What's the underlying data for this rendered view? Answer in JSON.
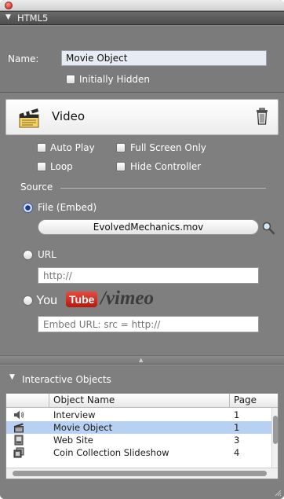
{
  "panel": {
    "section_title": "HTML5",
    "name_label": "Name:",
    "name_value": "Movie Object",
    "initially_hidden_label": "Initially Hidden"
  },
  "video": {
    "title": "Video",
    "options": {
      "auto_play": "Auto Play",
      "full_screen_only": "Full Screen Only",
      "loop": "Loop",
      "hide_controller": "Hide Controller"
    },
    "source_label": "Source",
    "file_option": "File (Embed)",
    "file_name": "EvolvedMechanics.mov",
    "url_option": "URL",
    "url_placeholder": "http://",
    "youtube_you": "You",
    "youtube_tube": "Tube",
    "vimeo_text": "/vimeo",
    "embed_placeholder": "Embed URL: src = http://",
    "selected_source": "File (Embed)"
  },
  "interactive_objects": {
    "title": "Interactive Objects",
    "columns": [
      "Object Name",
      "Page"
    ],
    "rows": [
      {
        "name": "Interview",
        "page": "1",
        "icon": "speaker-icon"
      },
      {
        "name": "Movie Object",
        "page": "1",
        "icon": "clapperboard-icon"
      },
      {
        "name": "Web Site",
        "page": "3",
        "icon": "web-widget-icon"
      },
      {
        "name": "Coin Collection Slideshow",
        "page": "4",
        "icon": "slideshow-icon"
      }
    ],
    "selected_row": "Movie Object"
  },
  "colors": {
    "panel_bg": "#7d7d7d",
    "selection": "#b8d1f3",
    "youtube_red": "#cc2014"
  }
}
